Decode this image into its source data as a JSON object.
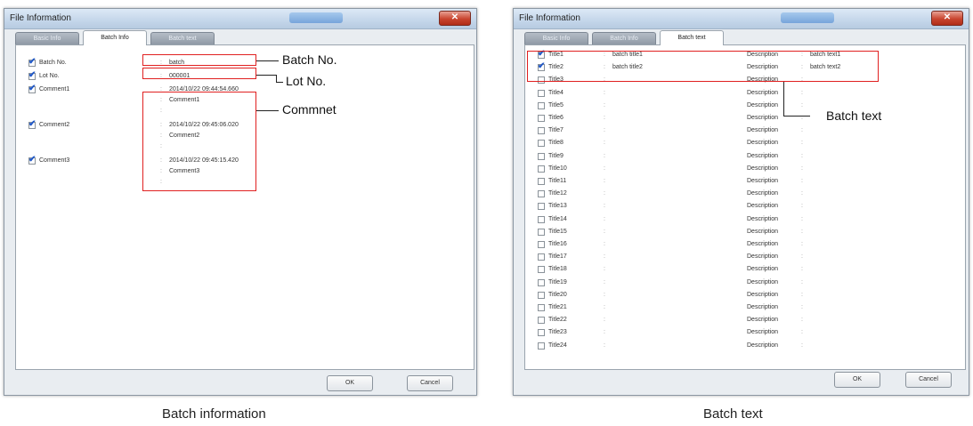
{
  "left": {
    "title": "File Information",
    "tabs": [
      "Basic Info",
      "Batch Info",
      "Batch text"
    ],
    "active_tab": 1,
    "rows": [
      {
        "label": "Batch No.",
        "checked": true,
        "value": "batch"
      },
      {
        "label": "Lot No.",
        "checked": true,
        "value": "000001"
      },
      {
        "label": "Comment1",
        "checked": true,
        "value": "2014/10/22 09:44:54.660",
        "extra": "Comment1"
      },
      {
        "label": "Comment2",
        "checked": true,
        "value": "2014/10/22 09:45:06.020",
        "extra": "Comment2"
      },
      {
        "label": "Comment3",
        "checked": true,
        "value": "2014/10/22 09:45:15.420",
        "extra": "Comment3"
      }
    ],
    "ok_label": "OK",
    "cancel_label": "Cancel",
    "callouts": {
      "batch_no": "Batch No.",
      "lot_no": "Lot No.",
      "comment": "Commnet"
    },
    "caption": "Batch information"
  },
  "right": {
    "title": "File Information",
    "tabs": [
      "Basic Info",
      "Batch Info",
      "Batch text"
    ],
    "active_tab": 2,
    "desc_label": "Description",
    "rows": [
      {
        "title": "Title1",
        "checked": true,
        "value": "batch title1",
        "desc": "batch text1"
      },
      {
        "title": "Title2",
        "checked": true,
        "value": "batch title2",
        "desc": "batch text2"
      },
      {
        "title": "Title3",
        "checked": false,
        "value": "",
        "desc": ""
      },
      {
        "title": "Title4",
        "checked": false,
        "value": "",
        "desc": ""
      },
      {
        "title": "Title5",
        "checked": false,
        "value": "",
        "desc": ""
      },
      {
        "title": "Title6",
        "checked": false,
        "value": "",
        "desc": ""
      },
      {
        "title": "Title7",
        "checked": false,
        "value": "",
        "desc": ""
      },
      {
        "title": "Title8",
        "checked": false,
        "value": "",
        "desc": ""
      },
      {
        "title": "Title9",
        "checked": false,
        "value": "",
        "desc": ""
      },
      {
        "title": "Title10",
        "checked": false,
        "value": "",
        "desc": ""
      },
      {
        "title": "Title11",
        "checked": false,
        "value": "",
        "desc": ""
      },
      {
        "title": "Title12",
        "checked": false,
        "value": "",
        "desc": ""
      },
      {
        "title": "Title13",
        "checked": false,
        "value": "",
        "desc": ""
      },
      {
        "title": "Title14",
        "checked": false,
        "value": "",
        "desc": ""
      },
      {
        "title": "Title15",
        "checked": false,
        "value": "",
        "desc": ""
      },
      {
        "title": "Title16",
        "checked": false,
        "value": "",
        "desc": ""
      },
      {
        "title": "Title17",
        "checked": false,
        "value": "",
        "desc": ""
      },
      {
        "title": "Title18",
        "checked": false,
        "value": "",
        "desc": ""
      },
      {
        "title": "Title19",
        "checked": false,
        "value": "",
        "desc": ""
      },
      {
        "title": "Title20",
        "checked": false,
        "value": "",
        "desc": ""
      },
      {
        "title": "Title21",
        "checked": false,
        "value": "",
        "desc": ""
      },
      {
        "title": "Title22",
        "checked": false,
        "value": "",
        "desc": ""
      },
      {
        "title": "Title23",
        "checked": false,
        "value": "",
        "desc": ""
      },
      {
        "title": "Title24",
        "checked": false,
        "value": "",
        "desc": ""
      }
    ],
    "ok_label": "OK",
    "cancel_label": "Cancel",
    "callouts": {
      "batch_text": "Batch text"
    },
    "caption": "Batch text"
  }
}
